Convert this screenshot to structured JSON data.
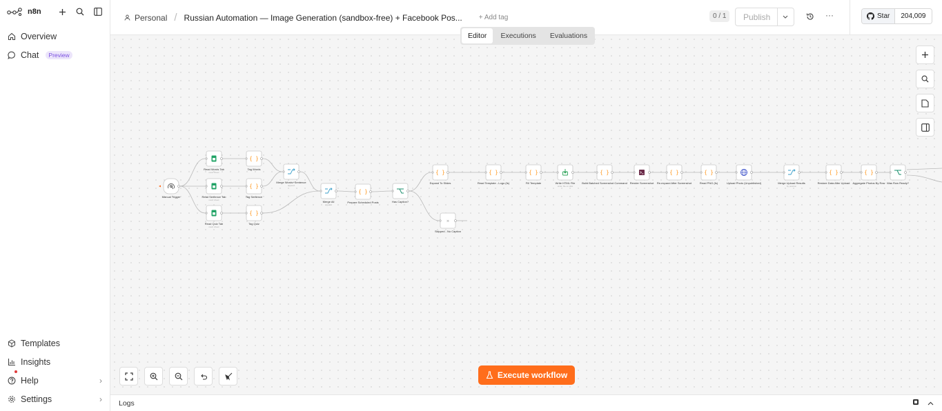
{
  "app": {
    "name": "n8n"
  },
  "sidebar": {
    "top": [
      {
        "label": "Overview",
        "icon": "home-icon"
      },
      {
        "label": "Chat",
        "icon": "chat-icon",
        "badge": "Preview"
      }
    ],
    "bottom": [
      {
        "label": "Templates",
        "icon": "templates-icon"
      },
      {
        "label": "Insights",
        "icon": "insights-icon"
      },
      {
        "label": "Help",
        "icon": "help-icon"
      },
      {
        "label": "Settings",
        "icon": "settings-icon"
      }
    ]
  },
  "header": {
    "project": "Personal",
    "workflow_title": "Russian Automation — Image Generation (sandbox-free) + Facebook Pos...",
    "add_tag": "+ Add tag",
    "counter": "0 / 1",
    "publish": "Publish",
    "github": {
      "star": "Star",
      "count": "204,009"
    }
  },
  "tabs": [
    "Editor",
    "Executions",
    "Evaluations"
  ],
  "canvas": {
    "execute_label": "Execute workflow",
    "nodes": [
      {
        "id": "manual",
        "label": "Manual Trigger",
        "kind": "trigger"
      },
      {
        "id": "rwt",
        "label": "Read Words Tab",
        "kind": "sheets",
        "sub": "read: sheet"
      },
      {
        "id": "rst",
        "label": "Read Sentence Tab",
        "kind": "sheets",
        "sub": "read: sheet"
      },
      {
        "id": "rqt",
        "label": "Read Quiz Tab",
        "kind": "sheets",
        "sub": "read: sheet"
      },
      {
        "id": "tw",
        "label": "Tag Words",
        "kind": "code"
      },
      {
        "id": "ts",
        "label": "Tag Sentence",
        "kind": "code"
      },
      {
        "id": "tq",
        "label": "Tag Quiz",
        "kind": "code"
      },
      {
        "id": "mws",
        "label": "Merge Words+Sentence",
        "kind": "merge",
        "sub": "append"
      },
      {
        "id": "mall",
        "label": "Merge All",
        "kind": "merge",
        "sub": "append"
      },
      {
        "id": "psp",
        "label": "Prepare Scheduled Posts",
        "kind": "code"
      },
      {
        "id": "hcap",
        "label": "Has Caption?",
        "kind": "if"
      },
      {
        "id": "expand",
        "label": "Expand To Slides",
        "kind": "code"
      },
      {
        "id": "skip",
        "label": "Skipped - No Caption",
        "kind": "noop"
      },
      {
        "id": "rtl",
        "label": "Read Template - Logo (fs)",
        "kind": "code"
      },
      {
        "id": "fill",
        "label": "Fill Template",
        "kind": "code"
      },
      {
        "id": "whtml",
        "label": "Write HTML File",
        "kind": "file",
        "sub": "write: file on disk"
      },
      {
        "id": "bssc",
        "label": "Build Batched Screenshot Command",
        "kind": "code"
      },
      {
        "id": "rscr",
        "label": "Render Screenshot",
        "kind": "exec"
      },
      {
        "id": "reexp",
        "label": "Re-expand After Screenshot",
        "kind": "code"
      },
      {
        "id": "rpng",
        "label": "Read PNG (fs)",
        "kind": "code"
      },
      {
        "id": "upl",
        "label": "Upload Photo (Unpublished)",
        "kind": "http"
      },
      {
        "id": "mur",
        "label": "Merge Upload Results",
        "kind": "merge",
        "sub": "by position"
      },
      {
        "id": "rdau",
        "label": "Restore Data After Upload",
        "kind": "code"
      },
      {
        "id": "apr",
        "label": "Aggregate Photos By Row",
        "kind": "code"
      },
      {
        "id": "wrr",
        "label": "Was Row Ready?",
        "kind": "if"
      }
    ]
  },
  "logs": {
    "label": "Logs"
  }
}
